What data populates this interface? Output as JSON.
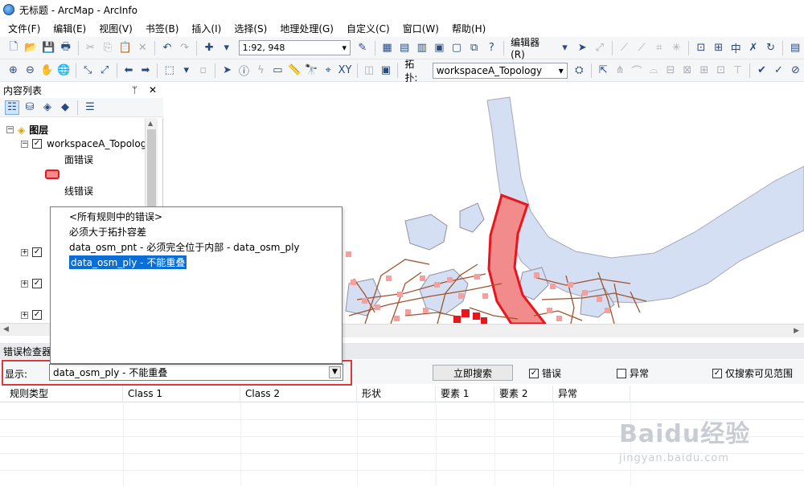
{
  "window": {
    "title": "无标题 - ArcMap - ArcInfo"
  },
  "menu": [
    "文件(F)",
    "编辑(E)",
    "视图(V)",
    "书签(B)",
    "插入(I)",
    "选择(S)",
    "地理处理(G)",
    "自定义(C)",
    "窗口(W)",
    "帮助(H)"
  ],
  "toolbar": {
    "scale": "1:92, 948",
    "editor_label": "编辑器(R)",
    "topology_label": "拓扑:",
    "topology_value": "workspaceA_Topology"
  },
  "toc": {
    "title": "内容列表",
    "pin": "ᛘ",
    "close": "✕",
    "root": "图层",
    "layer_name": "workspaceA_Topolog",
    "legend_polygon_errors": "面错误",
    "legend_line_errors": "线错误"
  },
  "dropdown": {
    "items": [
      "<所有规则中的错误>",
      "必须大于拓扑容差",
      "data_osm_pnt - 必须完全位于内部 - data_osm_ply",
      "data_osm_ply - 不能重叠"
    ],
    "selected_index": 3
  },
  "error_inspector": {
    "title": "错误检查器",
    "show_label": "显示:",
    "show_value": "data_osm_ply - 不能重叠",
    "search_button": "立即搜索",
    "errors_label": "错误",
    "errors_checked": true,
    "exceptions_label": "异常",
    "exceptions_checked": false,
    "visible_extent_label": "仅搜索可见范围",
    "visible_extent_checked": true,
    "columns": [
      "规则类型",
      "Class 1",
      "Class 2",
      "形状",
      "要素 1",
      "要素 2",
      "异常"
    ]
  },
  "watermark": {
    "brand": "Baidu经验",
    "url": "jingyan.baidu.com"
  },
  "colors": {
    "water": "#d5dff4",
    "error_fill": "#f28b8b",
    "error_outline": "#e8161c",
    "roads": "#a0522d",
    "highlight": "#e0383a"
  }
}
